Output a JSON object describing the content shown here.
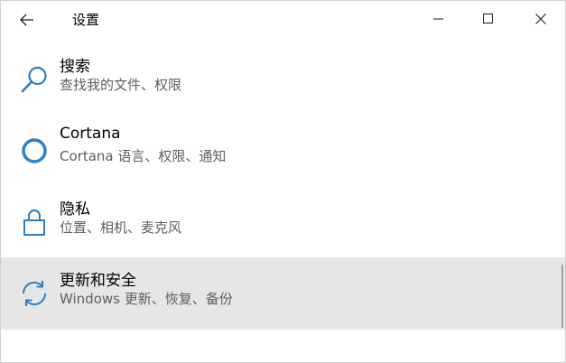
{
  "window": {
    "title": "设置",
    "accent_color": "#2d7fc1"
  },
  "titlebar": {
    "back_icon": "arrow-left-icon",
    "minimize_icon": "minimize-icon",
    "maximize_icon": "maximize-icon",
    "close_icon": "close-icon"
  },
  "items": [
    {
      "icon": "search-icon",
      "label": "搜索",
      "desc": "查找我的文件、权限",
      "selected": false
    },
    {
      "icon": "cortana-icon",
      "label": "Cortana",
      "desc": "Cortana 语言、权限、通知",
      "selected": false
    },
    {
      "icon": "lock-icon",
      "label": "隐私",
      "desc": "位置、相机、麦克风",
      "selected": false
    },
    {
      "icon": "refresh-icon",
      "label": "更新和安全",
      "desc": "Windows 更新、恢复、备份",
      "selected": true
    }
  ]
}
